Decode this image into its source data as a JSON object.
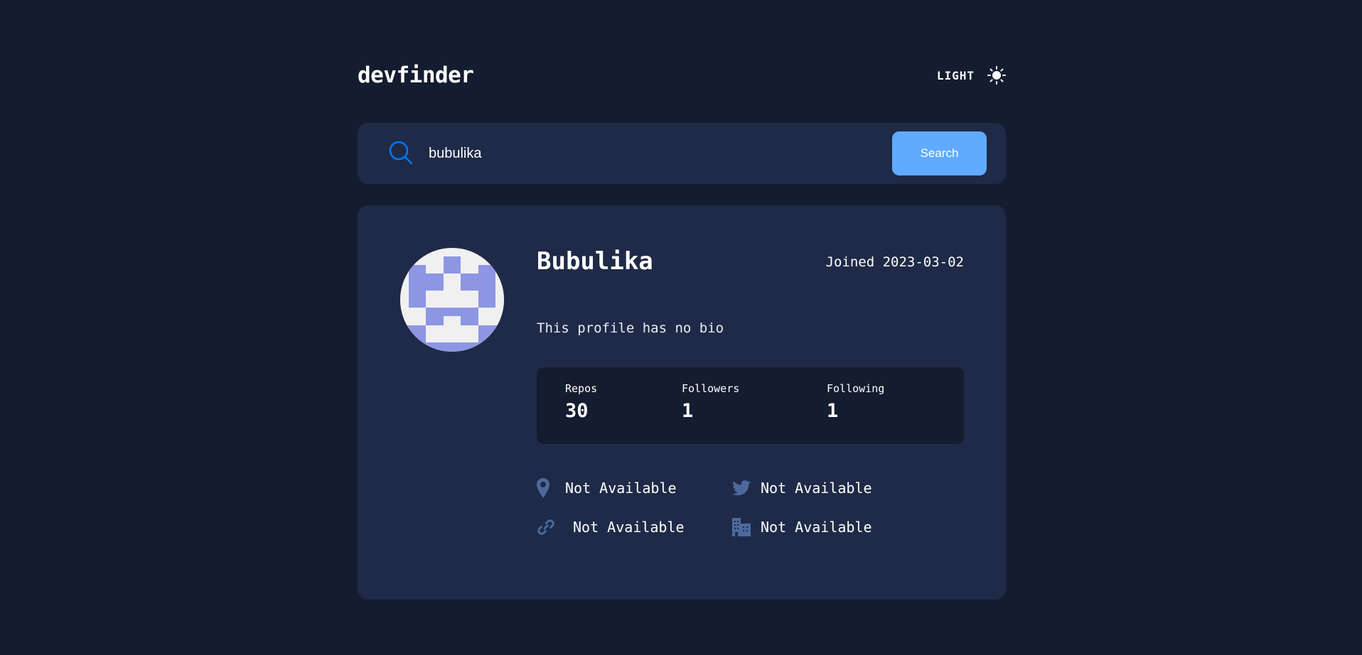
{
  "app": {
    "logo": "devfinder",
    "theme_toggle_label": "LIGHT",
    "theme_icon": "sun-icon"
  },
  "search": {
    "icon": "search-icon",
    "value": "bubulika",
    "placeholder": "",
    "button_label": "Search"
  },
  "profile": {
    "avatar_icon": "identicon-avatar",
    "name": "Bubulika",
    "joined": "Joined 2023-03-02",
    "bio": "This profile has no bio",
    "stats": [
      {
        "label": "Repos",
        "value": "30"
      },
      {
        "label": "Followers",
        "value": "1"
      },
      {
        "label": "Following",
        "value": "1"
      }
    ],
    "links": {
      "location": {
        "icon": "location-pin-icon",
        "text": "Not Available"
      },
      "twitter": {
        "icon": "twitter-icon",
        "text": "Not Available"
      },
      "website": {
        "icon": "link-icon",
        "text": "Not Available"
      },
      "company": {
        "icon": "company-building-icon",
        "text": "Not Available"
      }
    }
  },
  "colors": {
    "background": "#141c2f",
    "card": "#1e2a47",
    "accent": "#60abff",
    "search_icon": "#0079ff",
    "link_icon": "#4b6a9b",
    "avatar_fill": "#8d96e3",
    "avatar_bg": "#f0f0f0"
  }
}
